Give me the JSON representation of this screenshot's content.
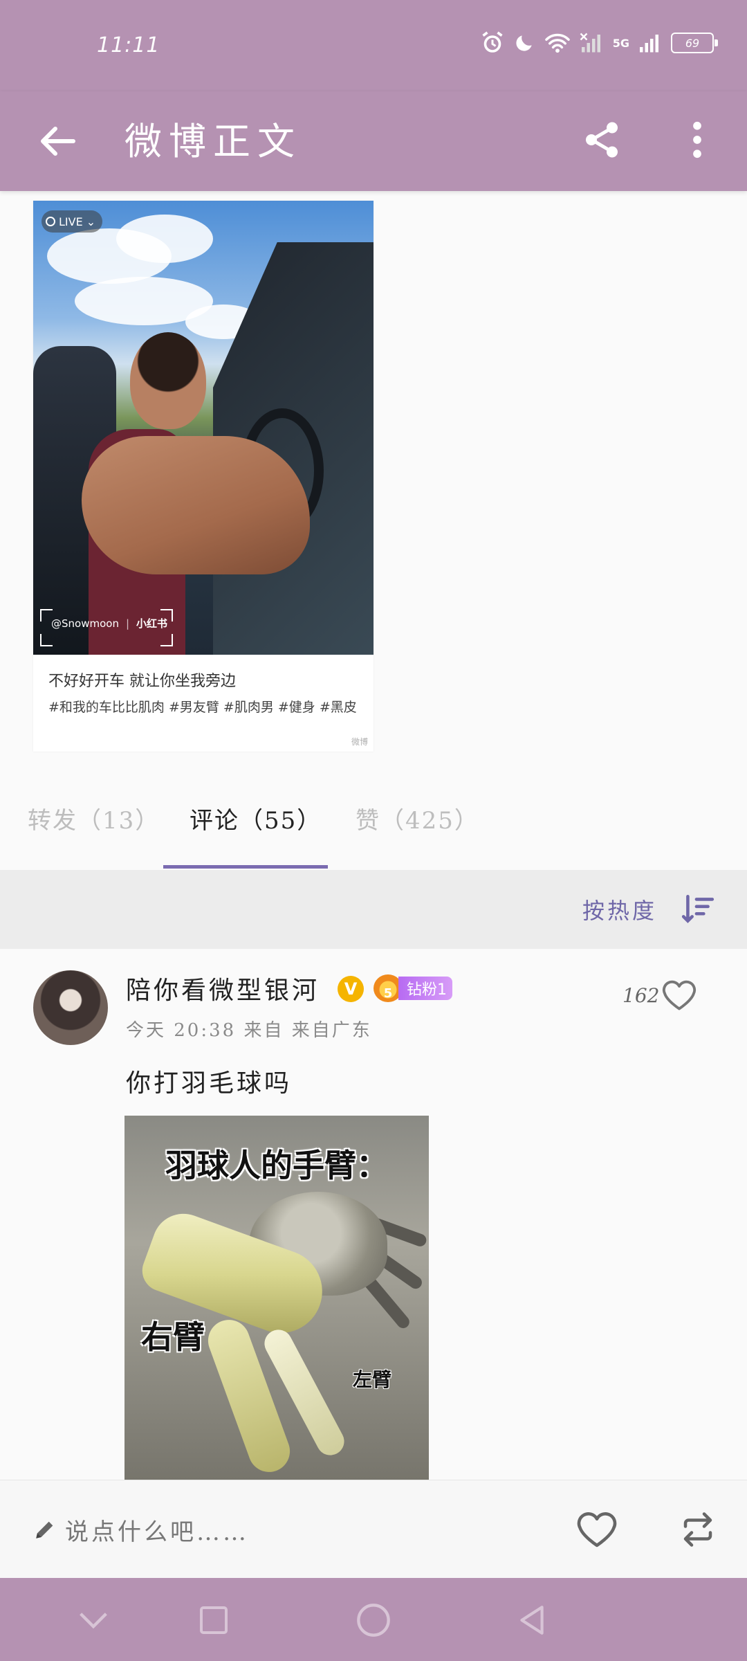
{
  "status_bar": {
    "time": "11:11",
    "network_label": "5G",
    "battery": "69"
  },
  "app_bar": {
    "title": "微博正文",
    "back_icon": "arrow-left-icon",
    "share_icon": "share-icon",
    "more_icon": "more-vertical-icon"
  },
  "post": {
    "live_label": "LIVE",
    "watermark_handle": "@Snowmoon",
    "watermark_brand": "小红书",
    "caption": "不好好开车 就让你坐我旁边",
    "tags": "#和我的车比比肌肉 #男友臂 #肌肉男 #健身 #黑皮"
  },
  "tabs": [
    {
      "label": "转发（13）",
      "active": false
    },
    {
      "label": "评论（55）",
      "active": true
    },
    {
      "label": "赞（425）",
      "active": false
    }
  ],
  "sort": {
    "label": "按热度",
    "icon": "sort-icon"
  },
  "comment": {
    "username": "陪你看微型银河",
    "verified_mark": "V",
    "fan_level": "5",
    "fan_badge": "钻粉1",
    "meta": "今天 20:38 来自 来自广东",
    "like_count": "162",
    "text": "你打羽毛球吗",
    "image": {
      "caption_top": "羽球人的手臂：",
      "label_right_arm": "右臂",
      "label_left_arm": "左臂"
    }
  },
  "compose": {
    "placeholder": "说点什么吧……"
  },
  "colors": {
    "bar": "#b592b2",
    "accent": "#7a6bb0",
    "sort_text": "#6f67a8"
  }
}
